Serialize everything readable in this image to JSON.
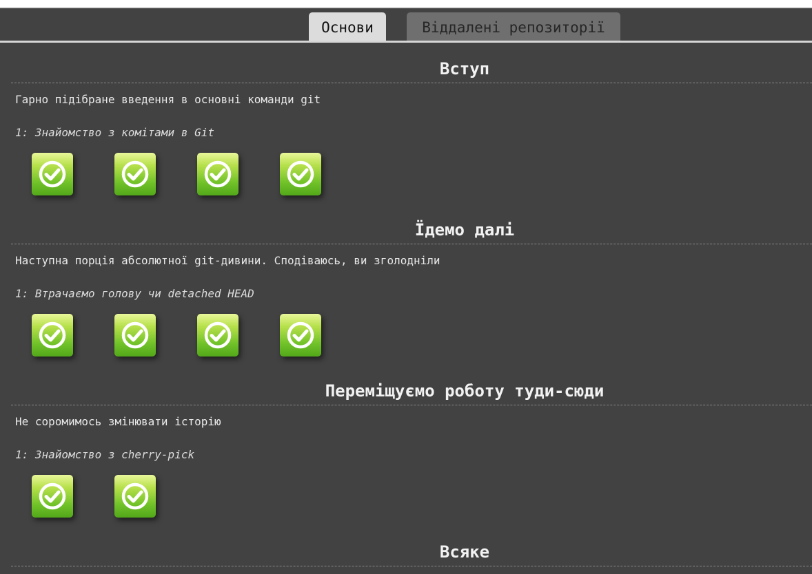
{
  "tabs": [
    {
      "label": "Основи",
      "active": true
    },
    {
      "label": "Віддалені репозиторії",
      "active": false
    }
  ],
  "sections": [
    {
      "title": "Вступ",
      "description": "Гарно підібране введення в основні команди git",
      "current_level": "1: Знайомство з комітами в Git",
      "levels_completed": 4
    },
    {
      "title": "Їдемо далі",
      "description": "Наступна порція абсолютної git-дивини. Сподіваюсь, ви зголодніли",
      "current_level": "1: Втрачаємо голову чи detached HEAD",
      "levels_completed": 4
    },
    {
      "title": "Переміщуємо роботу туди-сюди",
      "description": "Не соромимось змінювати історію",
      "current_level": "1: Знайомство з cherry-pick",
      "levels_completed": 2
    },
    {
      "title": "Всяке"
    }
  ],
  "icons": {
    "level": "check-circle-icon"
  },
  "colors": {
    "background": "#424242",
    "active_tab": "#dcdcdc",
    "inactive_tab": "#6f6f6f",
    "level_complete": "#71c229"
  }
}
